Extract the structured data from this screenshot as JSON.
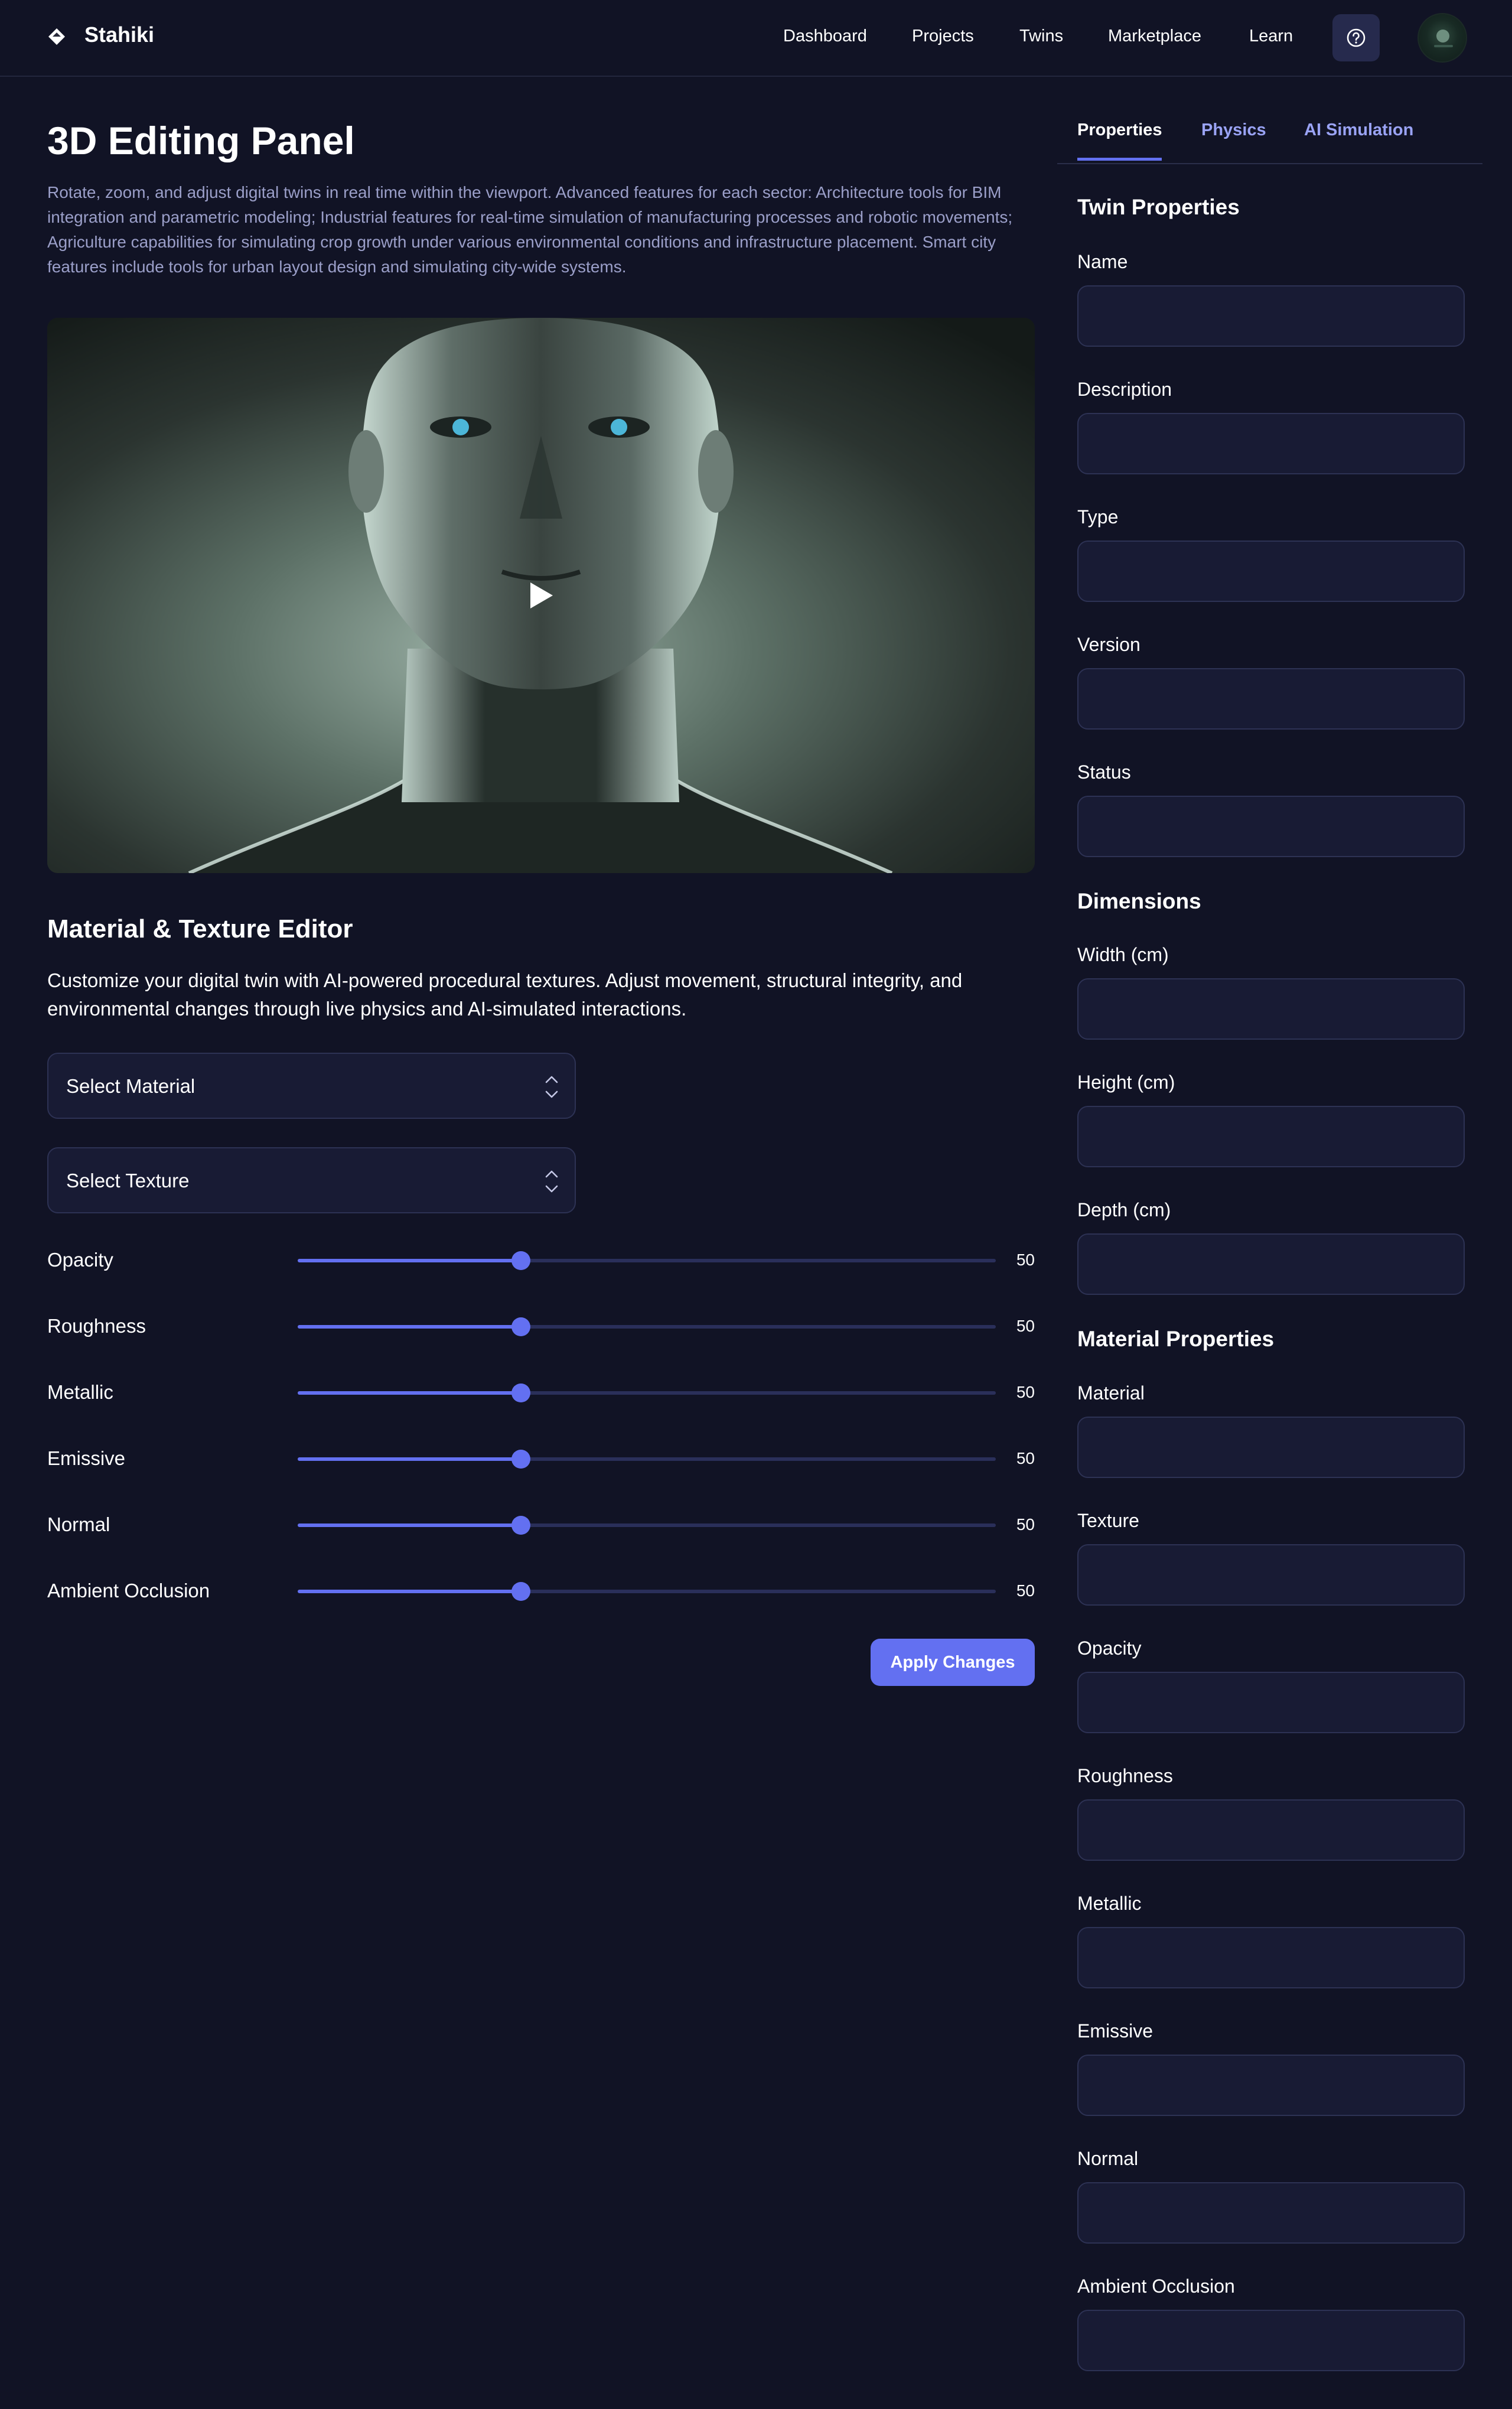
{
  "brand": {
    "name": "Stahiki",
    "logo_icon": "diamond-logo-icon"
  },
  "nav": {
    "links": [
      "Dashboard",
      "Projects",
      "Twins",
      "Marketplace",
      "Learn"
    ],
    "help_icon": "question-circle-icon",
    "avatar_icon": "user-avatar-icon"
  },
  "main": {
    "title": "3D Editing Panel",
    "description": "Rotate, zoom, and adjust digital twins in real time within the viewport. Advanced features for each sector: Architecture tools for BIM integration and parametric modeling; Industrial features for real-time simulation of manufacturing processes and robotic movements; Agriculture capabilities for simulating crop growth under various environmental conditions and infrastructure placement. Smart city features include tools for urban layout design and simulating city-wide systems.",
    "viewport": {
      "play_icon": "play-icon"
    }
  },
  "editor": {
    "title": "Material & Texture Editor",
    "description": "Customize your digital twin with AI-powered procedural textures. Adjust movement, structural integrity, and environmental changes through live physics and AI-simulated interactions.",
    "material_select": "Select Material",
    "texture_select": "Select Texture",
    "sliders": [
      {
        "label": "Opacity",
        "value": "50",
        "fraction": 0.32
      },
      {
        "label": "Roughness",
        "value": "50",
        "fraction": 0.32
      },
      {
        "label": "Metallic",
        "value": "50",
        "fraction": 0.32
      },
      {
        "label": "Emissive",
        "value": "50",
        "fraction": 0.32
      },
      {
        "label": "Normal",
        "value": "50",
        "fraction": 0.32
      },
      {
        "label": "Ambient Occlusion",
        "value": "50",
        "fraction": 0.32
      }
    ],
    "apply_label": "Apply Changes",
    "accent_color": "#6370f1"
  },
  "panel": {
    "tabs": [
      "Properties",
      "Physics",
      "AI Simulation"
    ],
    "active_tab": "Properties",
    "twin_properties": {
      "heading": "Twin Properties",
      "fields": [
        "Name",
        "Description",
        "Type",
        "Version",
        "Status"
      ]
    },
    "dimensions": {
      "heading": "Dimensions",
      "fields": [
        "Width (cm)",
        "Height (cm)",
        "Depth (cm)"
      ]
    },
    "material_properties": {
      "heading": "Material Properties",
      "fields": [
        "Material",
        "Texture",
        "Opacity",
        "Roughness",
        "Metallic",
        "Emissive",
        "Normal",
        "Ambient Occlusion"
      ]
    }
  },
  "colors": {
    "background": "#111325",
    "input_background": "#181b34",
    "accent": "#6370f1",
    "muted_text": "#9b9fc9"
  }
}
